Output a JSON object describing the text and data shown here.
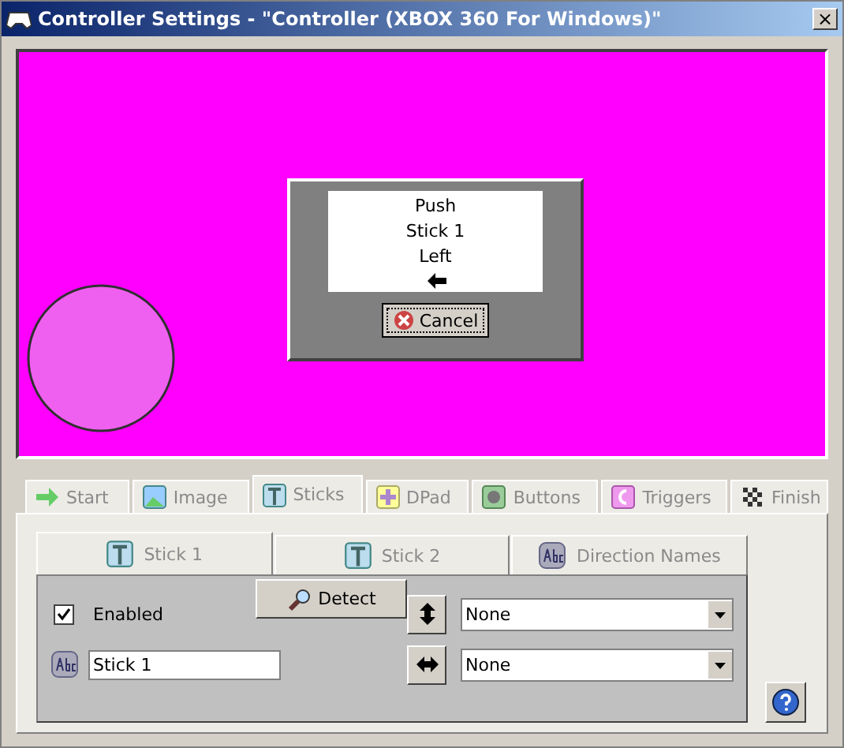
{
  "window": {
    "title": "Controller Settings - \"Controller (XBOX 360 For Windows)\"",
    "close": "×"
  },
  "preview": {
    "prompt": [
      "Push",
      "Stick 1",
      "Left"
    ],
    "cancel": "Cancel"
  },
  "tabs": [
    {
      "label": "Start",
      "selected": false
    },
    {
      "label": "Image",
      "selected": false
    },
    {
      "label": "Sticks",
      "selected": true
    },
    {
      "label": "DPad",
      "selected": false
    },
    {
      "label": "Buttons",
      "selected": false
    },
    {
      "label": "Triggers",
      "selected": false
    },
    {
      "label": "Finish",
      "selected": false
    }
  ],
  "subtabs": [
    {
      "label": "Stick 1",
      "selected": true
    },
    {
      "label": "Stick 2",
      "selected": false
    },
    {
      "label": "Direction Names",
      "selected": false
    }
  ],
  "enabled": {
    "label": "Enabled",
    "checked": true
  },
  "detect": "Detect",
  "name_field": {
    "value": "Stick 1"
  },
  "axes": [
    {
      "kind": "vertical",
      "value": "None"
    },
    {
      "kind": "horizontal",
      "value": "None"
    }
  ]
}
